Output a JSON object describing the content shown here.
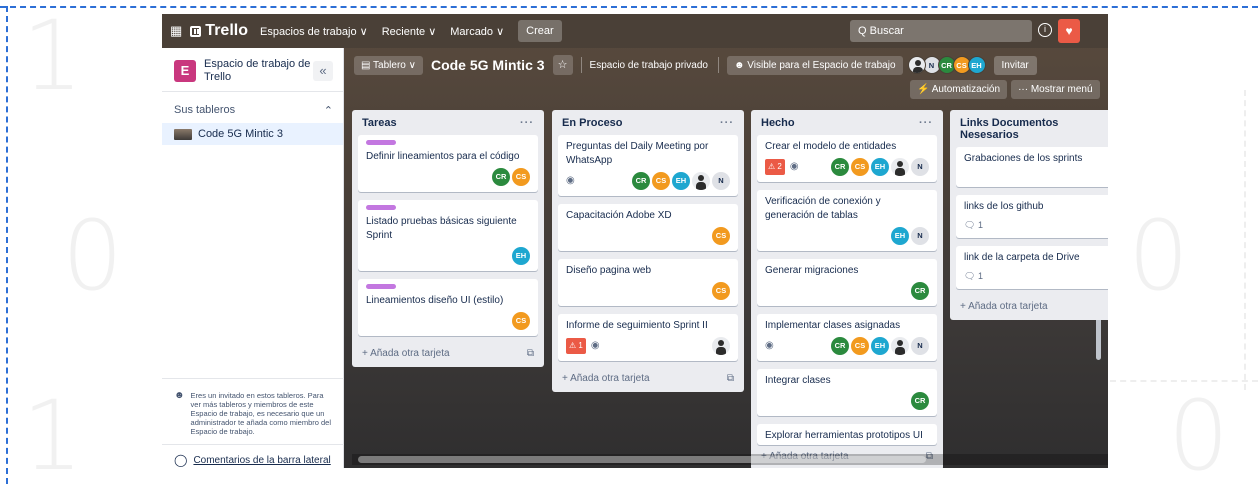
{
  "topbar": {
    "logo": "Trello",
    "nav": [
      "Espacios de trabajo ∨",
      "Reciente ∨",
      "Marcado ∨"
    ],
    "create": "Crear",
    "search_placeholder": "Q Buscar"
  },
  "sidebar": {
    "workspace_initial": "E",
    "workspace_name": "Espacio de trabajo de Trello",
    "boards_heading": "Sus tableros",
    "boards": [
      "Code 5G Mintic 3"
    ],
    "invite_note": "Eres un invitado en estos tableros. Para ver más tableros y miembros de este Espacio de trabajo, es necesario que un administrador te añada como miembro del Espacio de trabajo.",
    "feedback": "Comentarios de la barra lateral"
  },
  "board_header": {
    "view": "Tablero ∨",
    "title": "Code 5G Mintic 3",
    "workspace_visibility": "Espacio de trabajo privado",
    "visible": "Visible para el Espacio de trabajo",
    "invite": "Invitar",
    "automation": "Automatización",
    "show_menu": "Mostrar menú"
  },
  "lists": [
    {
      "title": "Tareas",
      "add": "+ Añada otra tarjeta",
      "cards": [
        {
          "text": "Definir lineamientos para el código"
        },
        {
          "text": "Listado pruebas básicas siguiente Sprint"
        },
        {
          "text": "Lineamientos diseño UI (estilo)"
        }
      ]
    },
    {
      "title": "En Proceso",
      "add": "+ Añada otra tarjeta",
      "cards": [
        {
          "text": "Preguntas del Daily Meeting por WhatsApp"
        },
        {
          "text": "Capacitación Adobe XD"
        },
        {
          "text": "Diseño pagina web"
        },
        {
          "text": "Informe de seguimiento Sprint II",
          "badge": "1"
        }
      ]
    },
    {
      "title": "Hecho",
      "add": "+ Añada otra tarjeta",
      "cards": [
        {
          "text": "Crear el modelo de entidades",
          "badge": "2"
        },
        {
          "text": "Verificación de conexión y generación de tablas"
        },
        {
          "text": "Generar migraciones"
        },
        {
          "text": "Implementar clases asignadas"
        },
        {
          "text": "Integrar clases"
        },
        {
          "text": "Explorar herramientas prototipos UI"
        }
      ]
    },
    {
      "title": "Links Documentos Nesesarios",
      "add": "+ Añada otra tarjeta",
      "cards": [
        {
          "text": "Grabaciones de los sprints"
        },
        {
          "text": "links de los github",
          "comments": "1"
        },
        {
          "text": "link de la carpeta de Drive",
          "comments": "1"
        }
      ]
    }
  ],
  "members": {
    "cr": "CR",
    "cs": "CS",
    "eh": "EH",
    "n": "N"
  },
  "decoration": {
    "digits": [
      "1",
      "0",
      "1",
      "0",
      "0"
    ]
  },
  "colors": {
    "label_purple": "#c377e0",
    "badge_red": "#eb5a46",
    "cr": "#2b8a3e",
    "cs": "#f29a1f",
    "eh": "#1ea7d0"
  }
}
